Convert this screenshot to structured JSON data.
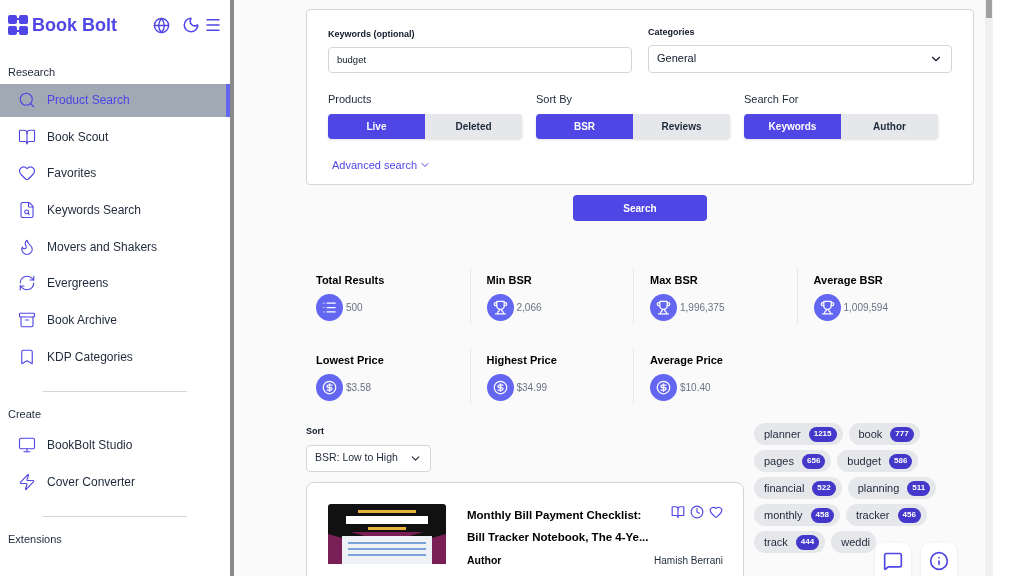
{
  "brand": "Book Bolt",
  "sidebar": {
    "sections": [
      {
        "title": "Research",
        "items": [
          {
            "label": "Product Search",
            "selected": true
          },
          {
            "label": "Book Scout",
            "selected": false
          },
          {
            "label": "Favorites",
            "selected": false
          },
          {
            "label": "Keywords Search",
            "selected": false
          },
          {
            "label": "Movers and Shakers",
            "selected": false
          },
          {
            "label": "Evergreens",
            "selected": false
          },
          {
            "label": "Book Archive",
            "selected": false
          },
          {
            "label": "KDP Categories",
            "selected": false
          }
        ]
      },
      {
        "title": "Create",
        "items": [
          {
            "label": "BookBolt Studio",
            "selected": false
          },
          {
            "label": "Cover Converter",
            "selected": false
          }
        ]
      },
      {
        "title": "Extensions"
      }
    ]
  },
  "form": {
    "keywords": {
      "label": "Keywords (optional)",
      "value": "budget"
    },
    "categories": {
      "label": "Categories",
      "value": "General"
    },
    "toggles": [
      {
        "label": "Products",
        "options": [
          {
            "label": "Live",
            "selected": true
          },
          {
            "label": "Deleted",
            "selected": false
          }
        ]
      },
      {
        "label": "Sort By",
        "options": [
          {
            "label": "BSR",
            "selected": true
          },
          {
            "label": "Reviews",
            "selected": false
          }
        ]
      },
      {
        "label": "Search For",
        "options": [
          {
            "label": "Keywords",
            "selected": true
          },
          {
            "label": "Author",
            "selected": false
          }
        ]
      }
    ],
    "advanced": "Advanced search",
    "search_button": "Search"
  },
  "stats": [
    {
      "label": "Total Results",
      "value": "500"
    },
    {
      "label": "Min BSR",
      "value": "2,066"
    },
    {
      "label": "Max BSR",
      "value": "1,996,375"
    },
    {
      "label": "Average BSR",
      "value": "1,009,594"
    },
    {
      "label": "Lowest Price",
      "value": "$3.58"
    },
    {
      "label": "Highest Price",
      "value": "$34.99"
    },
    {
      "label": "Average Price",
      "value": "$10.40"
    }
  ],
  "sort": {
    "label": "Sort",
    "value": "BSR: Low to High"
  },
  "results": [
    {
      "title": "Monthly Bill Payment Checklist: Bill Tracker Notebook, The 4-Ye...",
      "author_label": "Author",
      "author": "Hamish Berrani"
    }
  ],
  "tags": [
    {
      "word": "planner",
      "count": "1215"
    },
    {
      "word": "book",
      "count": "777"
    },
    {
      "word": "pages",
      "count": "656"
    },
    {
      "word": "budget",
      "count": "586"
    },
    {
      "word": "financial",
      "count": "522"
    },
    {
      "word": "planning",
      "count": "511"
    },
    {
      "word": "monthly",
      "count": "458"
    },
    {
      "word": "tracker",
      "count": "456"
    },
    {
      "word": "track",
      "count": "444"
    },
    {
      "word": "weddi"
    }
  ]
}
